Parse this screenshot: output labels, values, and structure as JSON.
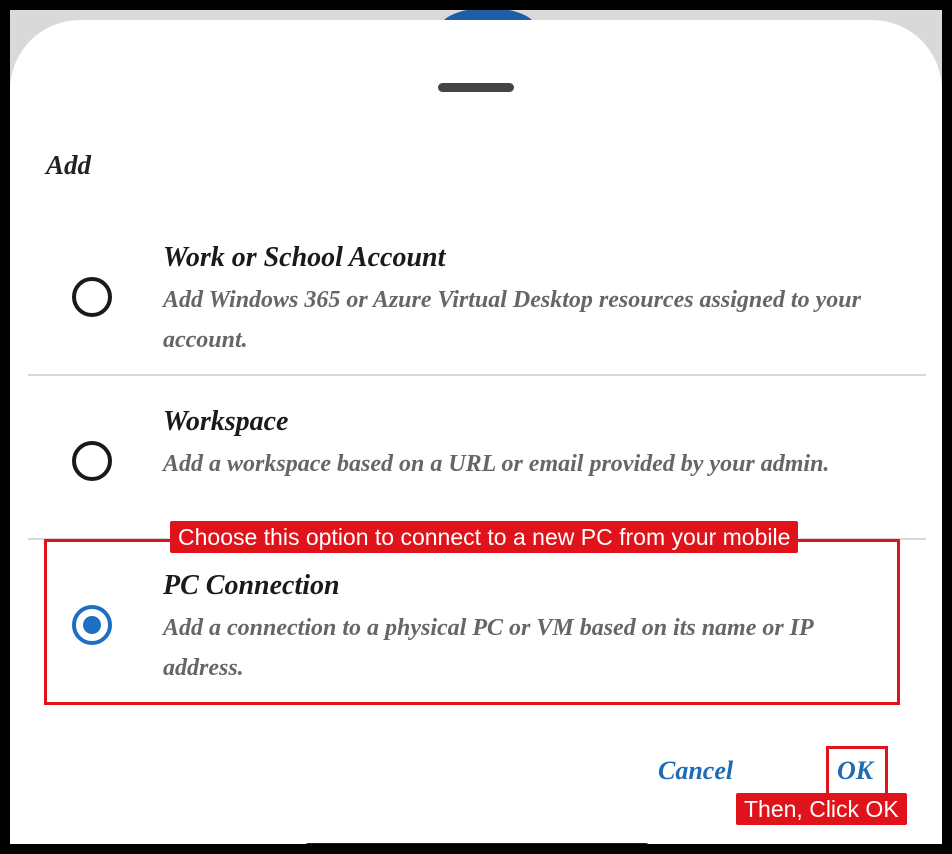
{
  "dialog": {
    "title": "Add",
    "options": [
      {
        "title": "Work or School Account",
        "description": "Add Windows 365 or Azure Virtual Desktop resources assigned to your account.",
        "selected": false
      },
      {
        "title": "Workspace",
        "description": "Add a workspace based on a URL or email provided by your admin.",
        "selected": false
      },
      {
        "title": "PC Connection",
        "description": "Add a connection to a physical PC or VM based on its name or IP address.",
        "selected": true
      }
    ],
    "cancel_label": "Cancel",
    "ok_label": "OK"
  },
  "annotations": {
    "option_callout": "Choose this option to connect to a new PC from your mobile",
    "ok_callout": "Then, Click OK",
    "highlight_color": "#e0131a"
  },
  "colors": {
    "accent": "#1e6fc2",
    "button_text": "#1f6cb3"
  }
}
